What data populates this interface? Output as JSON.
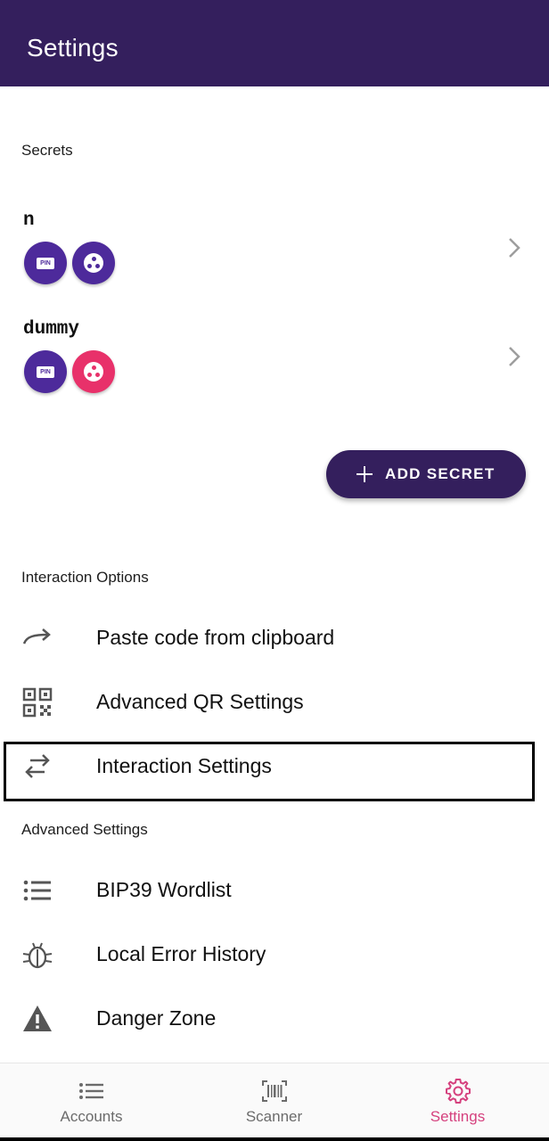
{
  "appbar": {
    "title": "Settings"
  },
  "sections": {
    "secrets": "Secrets",
    "interaction": "Interaction Options",
    "advanced": "Advanced Settings"
  },
  "secrets": [
    {
      "name": "n",
      "pin_label": "PIN",
      "dots_color": "#4d2a9b"
    },
    {
      "name": "dummy",
      "pin_label": "PIN",
      "dots_color": "#e8316a"
    }
  ],
  "add_secret": {
    "label": "ADD SECRET"
  },
  "interaction_items": [
    {
      "label": "Paste code from clipboard",
      "icon": "redirect-arrow-icon"
    },
    {
      "label": "Advanced QR Settings",
      "icon": "qr-code-icon"
    },
    {
      "label": "Interaction Settings",
      "icon": "swap-arrows-icon"
    }
  ],
  "advanced_items": [
    {
      "label": "BIP39 Wordlist",
      "icon": "list-icon"
    },
    {
      "label": "Local Error History",
      "icon": "bug-icon"
    },
    {
      "label": "Danger Zone",
      "icon": "warning-icon"
    }
  ],
  "bottom_nav": [
    {
      "label": "Accounts",
      "icon": "list-icon"
    },
    {
      "label": "Scanner",
      "icon": "barcode-icon"
    },
    {
      "label": "Settings",
      "icon": "gear-icon",
      "active": true
    }
  ],
  "colors": {
    "primary": "#341f5d",
    "accent": "#d5417e",
    "badge_purple": "#4d2a9b",
    "badge_pink": "#e8316a"
  }
}
